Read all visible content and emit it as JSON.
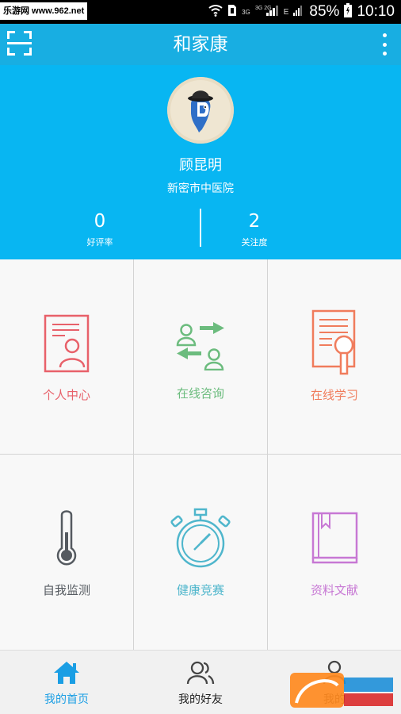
{
  "status_bar": {
    "watermark": "乐游网 www.962.net",
    "net_3g": "3G",
    "net_4g": "3G 2G",
    "net_e": "E",
    "battery": "85%",
    "time": "10:10"
  },
  "appbar": {
    "title": "和家康"
  },
  "profile": {
    "name": "顾昆明",
    "hospital": "新密市中医院",
    "stats": [
      {
        "value": "0",
        "label": "好评率"
      },
      {
        "value": "2",
        "label": "关注度"
      }
    ]
  },
  "grid": {
    "items": [
      {
        "label": "个人中心",
        "color": "#e8616a",
        "icon": "personal-card-icon"
      },
      {
        "label": "在线咨询",
        "color": "#6cbc7e",
        "icon": "consult-exchange-icon"
      },
      {
        "label": "在线学习",
        "color": "#f07c5c",
        "icon": "document-magnifier-icon"
      },
      {
        "label": "自我监测",
        "color": "#555a60",
        "icon": "thermometer-icon"
      },
      {
        "label": "健康竞赛",
        "color": "#4fb6cc",
        "icon": "stopwatch-icon"
      },
      {
        "label": "资料文献",
        "color": "#c778d4",
        "icon": "book-icon"
      }
    ]
  },
  "bottom_nav": {
    "tabs": [
      {
        "label": "我的首页",
        "active": true,
        "icon": "home-icon"
      },
      {
        "label": "我的好友",
        "active": false,
        "icon": "friends-icon"
      },
      {
        "label": "我的",
        "active": false,
        "icon": "profile-icon"
      }
    ]
  },
  "colors": {
    "appbar": "#18aee2",
    "profile_bg": "#08b6f2",
    "active_tab": "#1a9ee4"
  }
}
